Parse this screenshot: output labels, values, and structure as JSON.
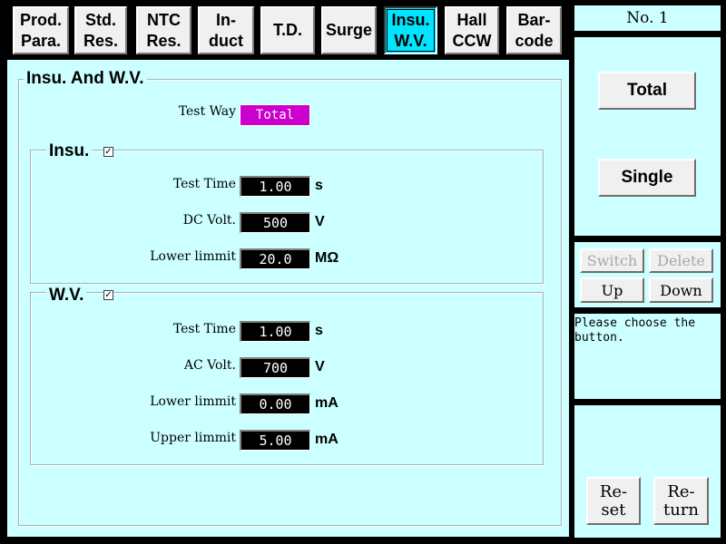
{
  "tabs": [
    {
      "label": "Prod.\nPara.",
      "active": false
    },
    {
      "label": "Std.\nRes.",
      "active": false
    },
    {
      "label": "NTC\nRes.",
      "active": false
    },
    {
      "label": "In-\nduct",
      "active": false
    },
    {
      "label": "T.D.",
      "active": false
    },
    {
      "label": "Surge",
      "active": false
    },
    {
      "label": "Insu.\nW.V.",
      "active": true
    },
    {
      "label": "Hall\nCCW",
      "active": false
    },
    {
      "label": "Bar-\ncode",
      "active": false
    }
  ],
  "main": {
    "title": "Insu. And W.V.",
    "test_way": {
      "label": "Test Way",
      "value": "Total",
      "color": "#cc00cc"
    },
    "insu": {
      "title": "Insu.",
      "checked": true,
      "check_glyph": "✓",
      "test_time": {
        "label": "Test Time",
        "value": "1.00",
        "unit": "s"
      },
      "dc_volt": {
        "label": "DC Volt.",
        "value": "500",
        "unit": "V"
      },
      "lower_limit": {
        "label": "Lower limmit",
        "value": "20.0",
        "unit": "MΩ"
      }
    },
    "wv": {
      "title": "W.V.",
      "checked": true,
      "check_glyph": "✓",
      "test_time": {
        "label": "Test Time",
        "value": "1.00",
        "unit": "s"
      },
      "ac_volt": {
        "label": "AC Volt.",
        "value": "700",
        "unit": "V"
      },
      "lower_limit": {
        "label": "Lower limmit",
        "value": "0.00",
        "unit": "mA"
      },
      "upper_limit": {
        "label": "Upper limmit",
        "value": "5.00",
        "unit": "mA"
      }
    }
  },
  "side": {
    "number": "No. 1",
    "total_label": "Total",
    "single_label": "Single",
    "switch_label": "Switch",
    "delete_label": "Delete",
    "up_label": "Up",
    "down_label": "Down",
    "message": "Please choose the button.",
    "reset_label": "Re-\nset",
    "return_label": "Re-\nturn"
  },
  "colors": {
    "panel_bg": "#ccffff",
    "active_tab": "#00e5ff",
    "field_bg": "#000000",
    "test_way_bg": "#cc00cc"
  }
}
